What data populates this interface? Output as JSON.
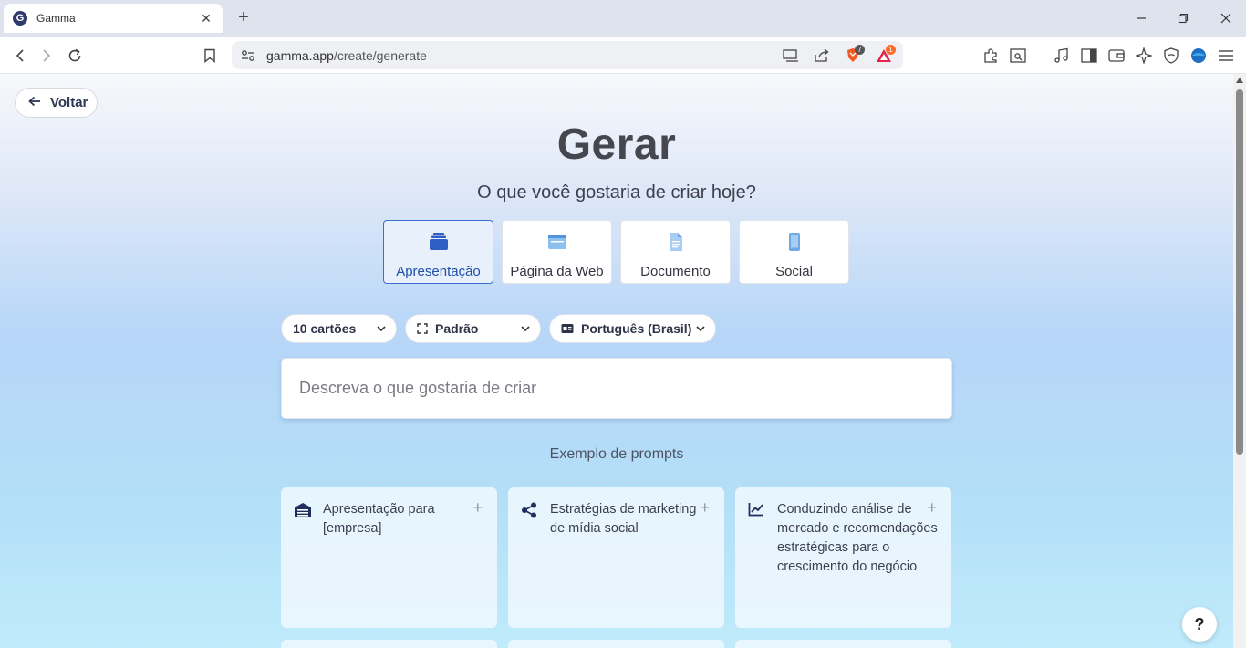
{
  "browser": {
    "tab_title": "Gamma",
    "tab_favicon_letter": "G",
    "url_domain": "gamma.app",
    "url_path": "/create/generate",
    "brave_shield_count": "7",
    "rewards_count": "1"
  },
  "page": {
    "back_label": "Voltar",
    "title": "Gerar",
    "subtitle": "O que você gostaria de criar hoje?",
    "types": [
      {
        "label": "Apresentação",
        "icon": "presentation-stack-icon",
        "active": true
      },
      {
        "label": "Página da Web",
        "icon": "webpage-icon",
        "active": false
      },
      {
        "label": "Documento",
        "icon": "document-icon",
        "active": false
      },
      {
        "label": "Social",
        "icon": "mobile-icon",
        "active": false
      }
    ],
    "dropdowns": {
      "cards": "10 cartões",
      "format": "Padrão",
      "language": "Português (Brasil)"
    },
    "prompt_placeholder": "Descreva o que gostaria de criar",
    "examples_heading": "Exemplo de prompts",
    "examples": [
      {
        "icon": "building-icon",
        "text": "Apresentação para [empresa]"
      },
      {
        "icon": "share-nodes-icon",
        "text": "Estratégias de marketing de mídia social"
      },
      {
        "icon": "line-chart-icon",
        "text": "Conduzindo análise de mercado e recomendações estratégicas para o crescimento do negócio"
      }
    ],
    "help_label": "?"
  },
  "colors": {
    "accent": "#3a6fd1",
    "accent_bg": "#e8f0fb",
    "icon_blue": "#2f5fc4",
    "icon_light_blue": "#7fb3ea"
  }
}
